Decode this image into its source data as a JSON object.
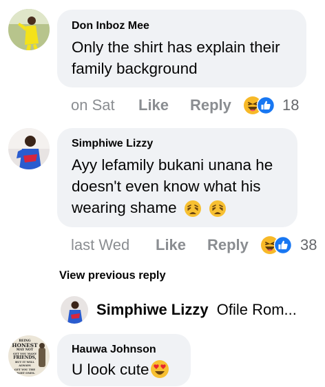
{
  "comments": [
    {
      "author": "Don Inboz Mee",
      "text_lines": [
        "Only the shirt has explain their",
        "family background"
      ],
      "time": "on Sat",
      "like": "Like",
      "reply": "Reply",
      "reaction_count": "18",
      "reaction_icons": [
        "haha-icon",
        "like-icon"
      ]
    },
    {
      "author": "Simphiwe Lizzy",
      "text_lines": [
        "Ayy lefamily bukani unana he",
        "doesn't even know what his",
        "wearing shame"
      ],
      "time": "last Wed",
      "like": "Like",
      "reply": "Reply",
      "reaction_count": "38",
      "reaction_icons": [
        "haha-icon",
        "like-icon"
      ]
    }
  ],
  "view_previous": "View previous reply",
  "reply_preview": {
    "author": "Simphiwe Lizzy",
    "text": "Ofile Rom..."
  },
  "last_comment": {
    "author": "Hauwa Johnson",
    "text": "U look cute",
    "avatar_text": [
      "BEING",
      "HONEST",
      "MAY NOT",
      "GET YOU MANY",
      "FRIENDS,",
      "BUT IT WILL",
      "ALWAYS",
      "GET YOU THE",
      "RIGHT ONES."
    ]
  },
  "colors": {
    "bubble": "#f0f2f5",
    "meta": "#8a8d91",
    "like_blue": "#1877f2",
    "haha_yellow": "#f7b928"
  }
}
